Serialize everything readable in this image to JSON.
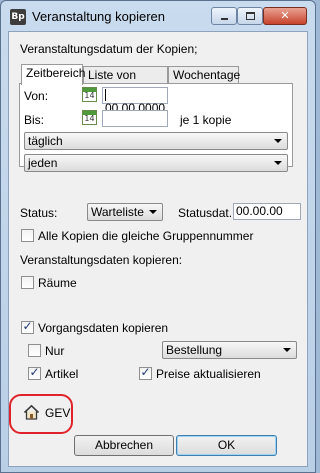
{
  "window": {
    "title": "Veranstaltung kopieren",
    "app_icon_text": "Bp",
    "minimize_glyph": "",
    "maximize_glyph": "",
    "close_glyph": "✕"
  },
  "section_label": "Veranstaltungsdatum der Kopien;",
  "tabs": [
    {
      "label": "Zeitbereich",
      "active": true
    },
    {
      "label": "Liste von Tagen",
      "active": false
    },
    {
      "label": "Wochentage",
      "active": false
    }
  ],
  "zeitbereich": {
    "von_label": "Von:",
    "von_value": "00.00.0000",
    "bis_label": "Bis:",
    "bis_value": "",
    "calendar_day": "14",
    "je_label": "je 1 kopie",
    "interval_select": "täglich",
    "every_select": "jeden"
  },
  "status": {
    "label": "Status:",
    "value": "Warteliste",
    "date_label": "Statusdat.:",
    "date_value": "00.00.00"
  },
  "gruppennummer": {
    "label": "Alle Kopien die gleiche Gruppennummer",
    "checked": false
  },
  "veranstaltungsdaten_label": "Veranstaltungsdaten kopieren:",
  "raeume": {
    "label": "Räume",
    "checked": false
  },
  "vorgangsdaten": {
    "label": "Vorgangsdaten kopieren",
    "checked": true
  },
  "nur": {
    "label": "Nur",
    "checked": false,
    "select_value": "Bestellung"
  },
  "artikel": {
    "label": "Artikel",
    "checked": true
  },
  "preise": {
    "label": "Preise aktualisieren",
    "checked": true
  },
  "gev": {
    "label": "GEV",
    "icon": "home-icon"
  },
  "buttons": {
    "cancel": "Abbrechen",
    "ok": "OK"
  },
  "colors": {
    "highlight": "#e0232a",
    "title_bar": "#c9dbee",
    "calendar": "#4e9a3a"
  }
}
